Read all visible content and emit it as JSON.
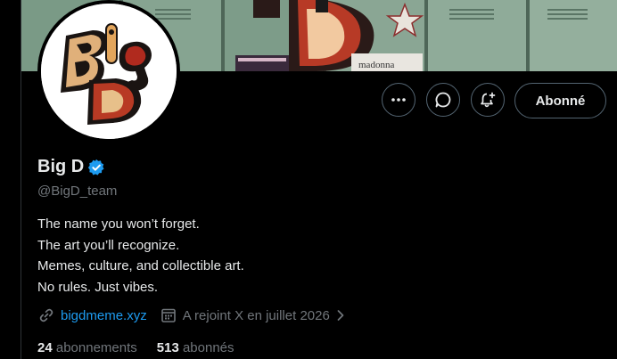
{
  "profile": {
    "display_name": "Big D",
    "handle": "@BigD_team",
    "verified": true,
    "avatar_text": "BigD",
    "bio_lines": [
      "The name you won’t forget.",
      "The art you’ll recognize.",
      "Memes, culture, and collectible art.",
      "No rules. Just vibes."
    ],
    "website": "bigdmeme.xyz",
    "joined": "A rejoint X en juillet 2026"
  },
  "actions": {
    "more_icon": "ellipsis-icon",
    "message_icon": "message-bubble-icon",
    "notify_icon": "bell-plus-icon",
    "follow_label": "Abonné"
  },
  "stats": {
    "following_count": "24",
    "following_label": "abonnements",
    "followers_count": "513",
    "followers_label": "abonnés"
  },
  "banner": {
    "sticker_text": "madonna"
  },
  "colors": {
    "background": "#000000",
    "text_primary": "#e7e9ea",
    "text_secondary": "#71767b",
    "link": "#1d9bf0",
    "verified": "#1d9bf0",
    "button_border": "#536471"
  }
}
